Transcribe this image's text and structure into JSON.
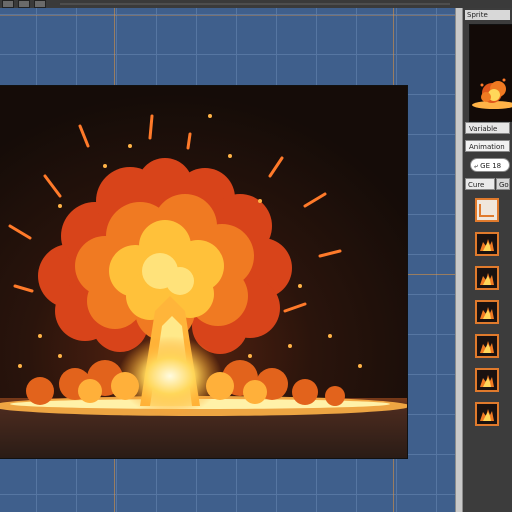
{
  "toolbar": {
    "buttons": [
      "swatch-1",
      "swatch-2",
      "swatch-3"
    ]
  },
  "panel": {
    "header_label": "Sprite",
    "row1_label": "Variable",
    "row2_label": "Animation",
    "search_value": "⤶ GE 18",
    "tabs": [
      "Cure",
      "Go"
    ]
  },
  "thumbnails": [
    {
      "name": "frame-1",
      "selected": true
    },
    {
      "name": "frame-2",
      "selected": false
    },
    {
      "name": "frame-3",
      "selected": false
    },
    {
      "name": "frame-4",
      "selected": false
    },
    {
      "name": "frame-5",
      "selected": false
    },
    {
      "name": "frame-6",
      "selected": false
    },
    {
      "name": "frame-7",
      "selected": false
    }
  ],
  "colors": {
    "canvas_bg": "#3f5f8c",
    "grid": "#5676a2",
    "guide": "#e6963c",
    "accent": "#e07a2c",
    "art_bg": "#1e120d"
  }
}
